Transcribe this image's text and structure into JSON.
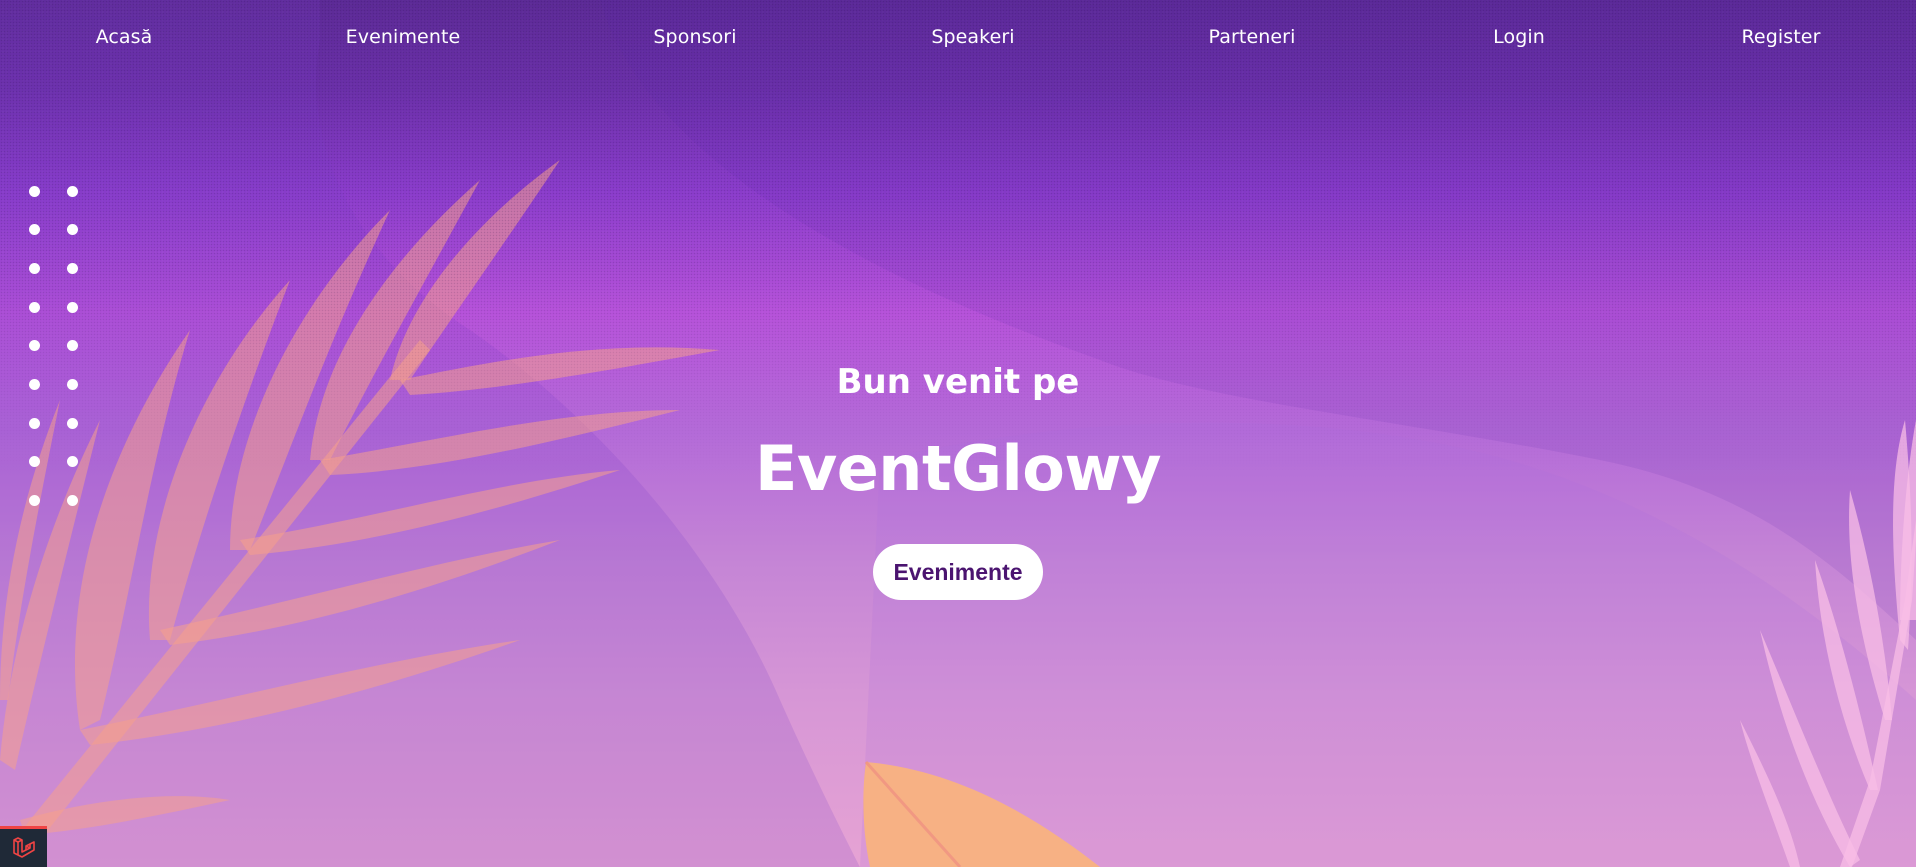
{
  "nav": {
    "items": [
      {
        "label": "Acasă"
      },
      {
        "label": "Evenimente"
      },
      {
        "label": "Sponsori"
      },
      {
        "label": "Speakeri"
      },
      {
        "label": "Parteneri"
      },
      {
        "label": "Login"
      },
      {
        "label": "Register"
      }
    ]
  },
  "hero": {
    "subtitle": "Bun venit pe",
    "title": "EventGlowy",
    "button_label": "Evenimente"
  },
  "debug_badge": {
    "icon": "laravel-icon",
    "accent": "#ef4444"
  },
  "colors": {
    "bg_top": "#5c2a96",
    "bg_mid": "#b652da",
    "bg_bottom": "#e6a3d4",
    "button_text": "#4b1470",
    "leaf_orange": "#f7a887",
    "leaf_pink": "#f5b6e0"
  }
}
